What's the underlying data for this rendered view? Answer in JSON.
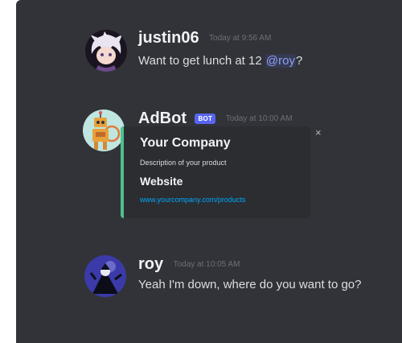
{
  "messages": [
    {
      "username": "justin06",
      "timestamp": "Today at 9:56 AM",
      "text_before": "Want to get lunch at 12 ",
      "mention": "@roy",
      "text_after": "?"
    },
    {
      "username": "AdBot",
      "badge": "BOT",
      "timestamp": "Today at 10:00 AM",
      "embed": {
        "title": "Your Company",
        "description": "Description of your product",
        "field_title": "Website",
        "link": "www.yourcompany.com/products",
        "accent_color": "#4fc08d",
        "close_icon": "×"
      }
    },
    {
      "username": "roy",
      "timestamp": "Today at 10:05 AM",
      "text": "Yeah I'm down, where do you want to go?"
    }
  ],
  "colors": {
    "background": "#313338",
    "mention": "#8ea1f6",
    "link": "#00a8fc",
    "bot_badge": "#5865f2"
  }
}
